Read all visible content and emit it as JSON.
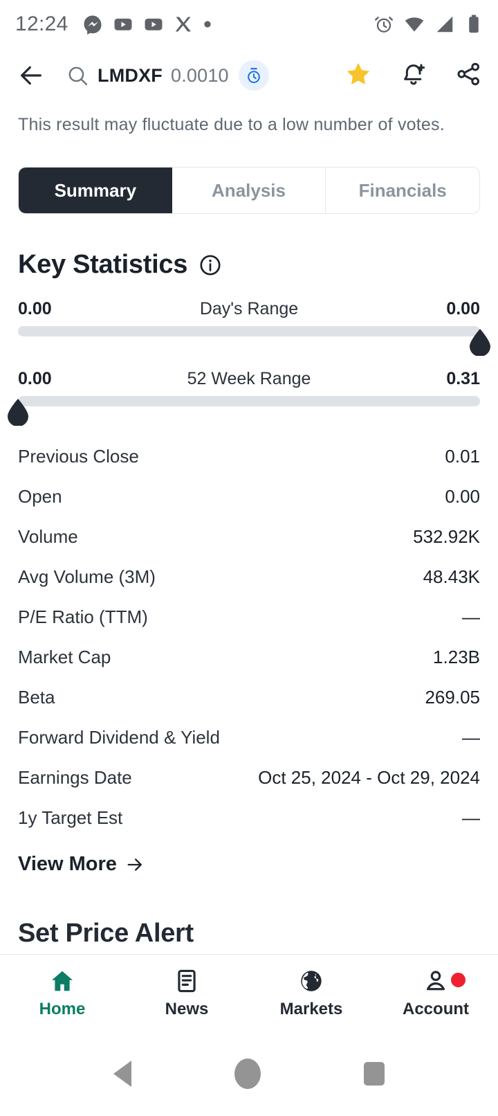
{
  "status_bar": {
    "time": "12:24",
    "left_icons": [
      "messenger-icon",
      "youtube-icon",
      "youtube-icon",
      "x-twitter-icon",
      "dot-icon"
    ],
    "right_icons": [
      "alarm-icon",
      "wifi-icon",
      "cell-signal-icon",
      "battery-icon"
    ]
  },
  "app_bar": {
    "back_icon": "arrow-left-icon",
    "search_icon": "search-icon",
    "ticker": "LMDXF",
    "price": "0.0010",
    "clock_icon": "stopwatch-icon",
    "clock_badge_color": "#eaf1fe",
    "clock_icon_color": "#1a73e8",
    "star_icon": "star-filled-icon",
    "star_color": "#f9c32b",
    "bell_icon": "bell-plus-icon",
    "share_icon": "share-icon"
  },
  "disclaimer": "This result may fluctuate due to a low number of votes.",
  "tabs": [
    {
      "label": "Summary",
      "active": true
    },
    {
      "label": "Analysis",
      "active": false
    },
    {
      "label": "Financials",
      "active": false
    }
  ],
  "key_statistics": {
    "title": "Key Statistics",
    "info_icon": "info-circle-icon",
    "ranges": [
      {
        "label": "Day's Range",
        "low": "0.00",
        "high": "0.00",
        "marker_position": "right"
      },
      {
        "label": "52 Week Range",
        "low": "0.00",
        "high": "0.31",
        "marker_position": "left"
      }
    ],
    "rows": [
      {
        "label": "Previous Close",
        "value": "0.01"
      },
      {
        "label": "Open",
        "value": "0.00"
      },
      {
        "label": "Volume",
        "value": "532.92K"
      },
      {
        "label": "Avg Volume (3M)",
        "value": "48.43K"
      },
      {
        "label": "P/E Ratio (TTM)",
        "value": "—"
      },
      {
        "label": "Market Cap",
        "value": "1.23B"
      },
      {
        "label": "Beta",
        "value": "269.05"
      },
      {
        "label": "Forward Dividend & Yield",
        "value": "—"
      },
      {
        "label": "Earnings Date",
        "value": "Oct 25, 2024 - Oct 29, 2024"
      },
      {
        "label": "1y Target Est",
        "value": "—"
      }
    ],
    "view_more": "View More",
    "view_more_icon": "arrow-right-icon"
  },
  "set_price_alert": {
    "title": "Set Price Alert"
  },
  "bottom_nav": {
    "active_color": "#0a7d63",
    "inactive_color": "#232a33",
    "badge_color": "#ef2130",
    "items": [
      {
        "label": "Home",
        "icon": "home-icon",
        "active": true,
        "badge": false
      },
      {
        "label": "News",
        "icon": "news-icon",
        "active": false,
        "badge": false
      },
      {
        "label": "Markets",
        "icon": "globe-icon",
        "active": false,
        "badge": false
      },
      {
        "label": "Account",
        "icon": "person-icon",
        "active": false,
        "badge": true
      }
    ]
  },
  "android_nav": {
    "back": "back-triangle-icon",
    "home": "home-circle-icon",
    "recents": "recents-square-icon"
  }
}
